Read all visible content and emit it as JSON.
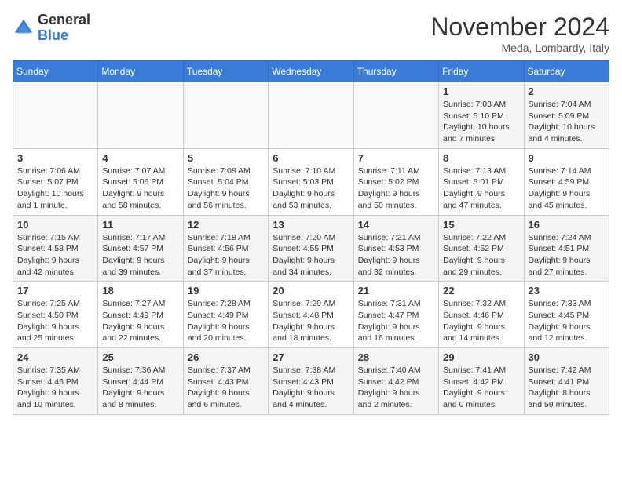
{
  "logo": {
    "general": "General",
    "blue": "Blue"
  },
  "title": "November 2024",
  "location": "Meda, Lombardy, Italy",
  "days_of_week": [
    "Sunday",
    "Monday",
    "Tuesday",
    "Wednesday",
    "Thursday",
    "Friday",
    "Saturday"
  ],
  "weeks": [
    [
      {
        "day": "",
        "info": ""
      },
      {
        "day": "",
        "info": ""
      },
      {
        "day": "",
        "info": ""
      },
      {
        "day": "",
        "info": ""
      },
      {
        "day": "",
        "info": ""
      },
      {
        "day": "1",
        "info": "Sunrise: 7:03 AM\nSunset: 5:10 PM\nDaylight: 10 hours and 7 minutes."
      },
      {
        "day": "2",
        "info": "Sunrise: 7:04 AM\nSunset: 5:09 PM\nDaylight: 10 hours and 4 minutes."
      }
    ],
    [
      {
        "day": "3",
        "info": "Sunrise: 7:06 AM\nSunset: 5:07 PM\nDaylight: 10 hours and 1 minute."
      },
      {
        "day": "4",
        "info": "Sunrise: 7:07 AM\nSunset: 5:06 PM\nDaylight: 9 hours and 58 minutes."
      },
      {
        "day": "5",
        "info": "Sunrise: 7:08 AM\nSunset: 5:04 PM\nDaylight: 9 hours and 56 minutes."
      },
      {
        "day": "6",
        "info": "Sunrise: 7:10 AM\nSunset: 5:03 PM\nDaylight: 9 hours and 53 minutes."
      },
      {
        "day": "7",
        "info": "Sunrise: 7:11 AM\nSunset: 5:02 PM\nDaylight: 9 hours and 50 minutes."
      },
      {
        "day": "8",
        "info": "Sunrise: 7:13 AM\nSunset: 5:01 PM\nDaylight: 9 hours and 47 minutes."
      },
      {
        "day": "9",
        "info": "Sunrise: 7:14 AM\nSunset: 4:59 PM\nDaylight: 9 hours and 45 minutes."
      }
    ],
    [
      {
        "day": "10",
        "info": "Sunrise: 7:15 AM\nSunset: 4:58 PM\nDaylight: 9 hours and 42 minutes."
      },
      {
        "day": "11",
        "info": "Sunrise: 7:17 AM\nSunset: 4:57 PM\nDaylight: 9 hours and 39 minutes."
      },
      {
        "day": "12",
        "info": "Sunrise: 7:18 AM\nSunset: 4:56 PM\nDaylight: 9 hours and 37 minutes."
      },
      {
        "day": "13",
        "info": "Sunrise: 7:20 AM\nSunset: 4:55 PM\nDaylight: 9 hours and 34 minutes."
      },
      {
        "day": "14",
        "info": "Sunrise: 7:21 AM\nSunset: 4:53 PM\nDaylight: 9 hours and 32 minutes."
      },
      {
        "day": "15",
        "info": "Sunrise: 7:22 AM\nSunset: 4:52 PM\nDaylight: 9 hours and 29 minutes."
      },
      {
        "day": "16",
        "info": "Sunrise: 7:24 AM\nSunset: 4:51 PM\nDaylight: 9 hours and 27 minutes."
      }
    ],
    [
      {
        "day": "17",
        "info": "Sunrise: 7:25 AM\nSunset: 4:50 PM\nDaylight: 9 hours and 25 minutes."
      },
      {
        "day": "18",
        "info": "Sunrise: 7:27 AM\nSunset: 4:49 PM\nDaylight: 9 hours and 22 minutes."
      },
      {
        "day": "19",
        "info": "Sunrise: 7:28 AM\nSunset: 4:49 PM\nDaylight: 9 hours and 20 minutes."
      },
      {
        "day": "20",
        "info": "Sunrise: 7:29 AM\nSunset: 4:48 PM\nDaylight: 9 hours and 18 minutes."
      },
      {
        "day": "21",
        "info": "Sunrise: 7:31 AM\nSunset: 4:47 PM\nDaylight: 9 hours and 16 minutes."
      },
      {
        "day": "22",
        "info": "Sunrise: 7:32 AM\nSunset: 4:46 PM\nDaylight: 9 hours and 14 minutes."
      },
      {
        "day": "23",
        "info": "Sunrise: 7:33 AM\nSunset: 4:45 PM\nDaylight: 9 hours and 12 minutes."
      }
    ],
    [
      {
        "day": "24",
        "info": "Sunrise: 7:35 AM\nSunset: 4:45 PM\nDaylight: 9 hours and 10 minutes."
      },
      {
        "day": "25",
        "info": "Sunrise: 7:36 AM\nSunset: 4:44 PM\nDaylight: 9 hours and 8 minutes."
      },
      {
        "day": "26",
        "info": "Sunrise: 7:37 AM\nSunset: 4:43 PM\nDaylight: 9 hours and 6 minutes."
      },
      {
        "day": "27",
        "info": "Sunrise: 7:38 AM\nSunset: 4:43 PM\nDaylight: 9 hours and 4 minutes."
      },
      {
        "day": "28",
        "info": "Sunrise: 7:40 AM\nSunset: 4:42 PM\nDaylight: 9 hours and 2 minutes."
      },
      {
        "day": "29",
        "info": "Sunrise: 7:41 AM\nSunset: 4:42 PM\nDaylight: 9 hours and 0 minutes."
      },
      {
        "day": "30",
        "info": "Sunrise: 7:42 AM\nSunset: 4:41 PM\nDaylight: 8 hours and 59 minutes."
      }
    ]
  ]
}
